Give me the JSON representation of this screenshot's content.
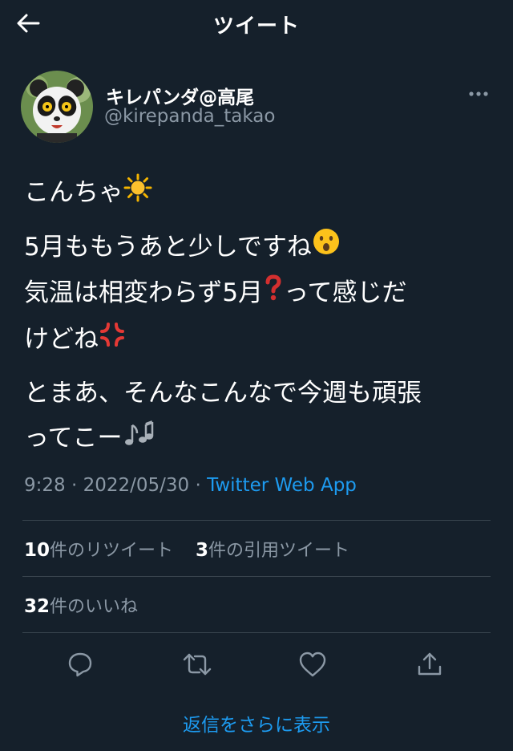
{
  "header": {
    "title": "ツイート"
  },
  "author": {
    "display_name": "キレパンダ@高尾",
    "handle": "@kirepanda_takao"
  },
  "tweet": {
    "greeting": "こんちゃ",
    "line1": "5月ももうあと少しですね",
    "line2a": "気温は相変わらず5月",
    "line2b": "って感じだ",
    "line2c": "けどね",
    "line3": "とまあ、そんなこんなで今週も頑張",
    "line4": "ってこー"
  },
  "meta": {
    "time": "9:28",
    "sep": " · ",
    "date": "2022/05/30",
    "via": "Twitter Web App"
  },
  "stats": {
    "retweets_count": "10",
    "retweets_label": "件のリツイート",
    "quotes_count": "3",
    "quotes_label": "件の引用ツイート",
    "likes_count": "32",
    "likes_label": "件のいいね"
  },
  "footer": {
    "more_replies": "返信をさらに表示"
  },
  "colors": {
    "background": "#15202b",
    "accent": "#1d9bf0",
    "secondary_text": "#8b98a5",
    "divider": "#38444d"
  },
  "icons": [
    "back-arrow-icon",
    "more-dots-icon",
    "sun-emoji",
    "hushed-face-emoji",
    "red-question-emoji",
    "anger-emoji",
    "musical-notes-emoji",
    "reply-icon",
    "retweet-icon",
    "like-icon",
    "share-icon"
  ]
}
